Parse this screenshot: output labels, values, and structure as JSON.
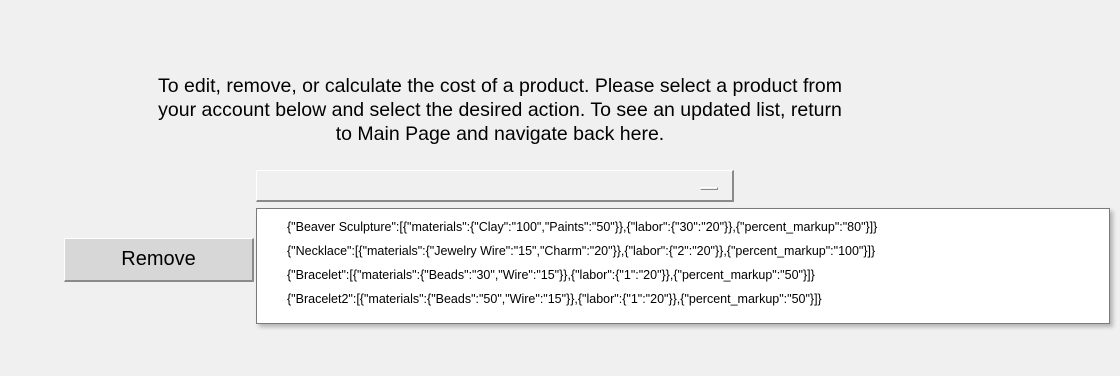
{
  "instructions": "To edit, remove, or calculate the cost of a product. Please select a product from\nyour account below and select the desired action. To see an updated list, return\nto Main Page and navigate back here.",
  "product_select": {
    "selected": "",
    "options": [
      "{\"Beaver Sculpture\":[{\"materials\":{\"Clay\":\"100\",\"Paints\":\"50\"}},{\"labor\":{\"30\":\"20\"}},{\"percent_markup\":\"80\"}]}",
      "{\"Necklace\":[{\"materials\":{\"Jewelry Wire\":\"15\",\"Charm\":\"20\"}},{\"labor\":{\"2\":\"20\"}},{\"percent_markup\":\"100\"}]}",
      "{\"Bracelet\":[{\"materials\":{\"Beads\":\"30\",\"Wire\":\"15\"}},{\"labor\":{\"1\":\"20\"}},{\"percent_markup\":\"50\"}]}",
      "{\"Bracelet2\":[{\"materials\":{\"Beads\":\"50\",\"Wire\":\"15\"}},{\"labor\":{\"1\":\"20\"}},{\"percent_markup\":\"50\"}]}"
    ]
  },
  "buttons": {
    "remove_label": "Remove"
  },
  "icons": {
    "combo_indicator": "option-menu-indicator-icon"
  }
}
